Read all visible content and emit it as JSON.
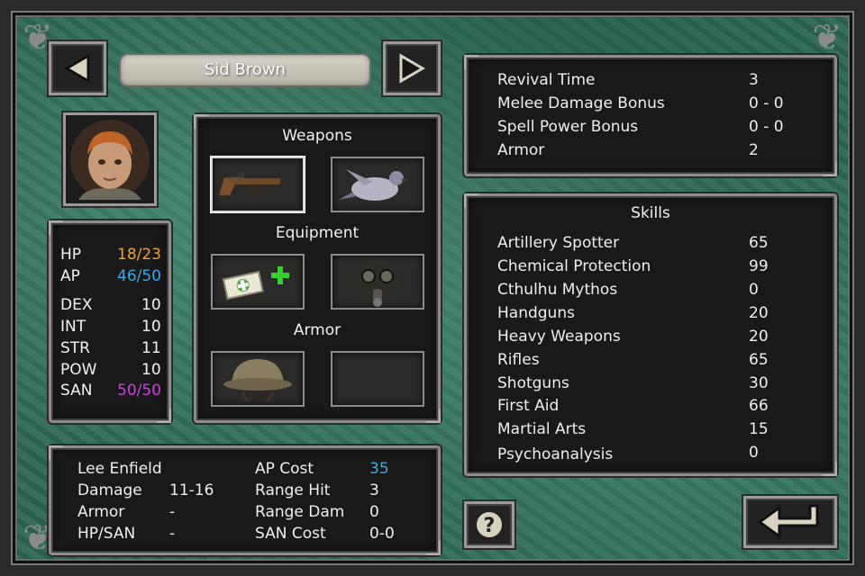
{
  "character": {
    "name": "Sid Brown",
    "stats": {
      "hp_label": "HP",
      "hp_value": "18/23",
      "ap_label": "AP",
      "ap_value": "46/50",
      "dex_label": "DEX",
      "dex_value": "10",
      "int_label": "INT",
      "int_value": "10",
      "str_label": "STR",
      "str_value": "11",
      "pow_label": "POW",
      "pow_value": "10",
      "san_label": "SAN",
      "san_value": "50/50"
    }
  },
  "loadout": {
    "weapons_title": "Weapons",
    "equipment_title": "Equipment",
    "armor_title": "Armor",
    "slots": [
      {
        "section": "weapons",
        "icon": "rifle-icon",
        "selected": true
      },
      {
        "section": "weapons",
        "icon": "pigeon-icon",
        "selected": false
      },
      {
        "section": "equipment",
        "icon": "first-aid-kit-icon",
        "selected": false
      },
      {
        "section": "equipment",
        "icon": "gas-mask-icon",
        "selected": false
      },
      {
        "section": "armor",
        "icon": "helmet-icon",
        "selected": false
      },
      {
        "section": "armor",
        "icon": "empty-slot",
        "selected": false
      }
    ]
  },
  "bonuses": [
    {
      "label": "Revival Time",
      "value": "3"
    },
    {
      "label": "Melee Damage Bonus",
      "value": "0 - 0"
    },
    {
      "label": "Spell Power Bonus",
      "value": "0 - 0"
    },
    {
      "label": "Armor",
      "value": "2"
    }
  ],
  "skills": {
    "title": "Skills",
    "items": [
      {
        "label": "Artillery Spotter",
        "value": "65"
      },
      {
        "label": "Chemical Protection",
        "value": "99"
      },
      {
        "label": "Cthulhu Mythos",
        "value": "0"
      },
      {
        "label": "Handguns",
        "value": "20"
      },
      {
        "label": "Heavy Weapons",
        "value": "20"
      },
      {
        "label": "Rifles",
        "value": "65"
      },
      {
        "label": "Shotguns",
        "value": "30"
      },
      {
        "label": "First Aid",
        "value": "66"
      },
      {
        "label": "Martial Arts",
        "value": "15"
      },
      {
        "label": "Psychoanalysis",
        "value": "0"
      }
    ]
  },
  "item_details": {
    "name": "Lee Enfield",
    "damage_label": "Damage",
    "damage_value": "11-16",
    "armor_label": "Armor",
    "armor_value": "-",
    "hpsan_label": "HP/SAN",
    "hpsan_value": "-",
    "apcost_label": "AP Cost",
    "apcost_value": "35",
    "rangehit_label": "Range Hit",
    "rangehit_value": "3",
    "rangedam_label": "Range Dam",
    "rangedam_value": "0",
    "sancost_label": "SAN Cost",
    "sancost_value": "0-0"
  },
  "colors": {
    "hp": "#f0a030",
    "ap": "#39a7e8",
    "san": "#d43be0",
    "ap_cost": "#3aa9e0",
    "first_aid_cross": "#36d12c"
  }
}
